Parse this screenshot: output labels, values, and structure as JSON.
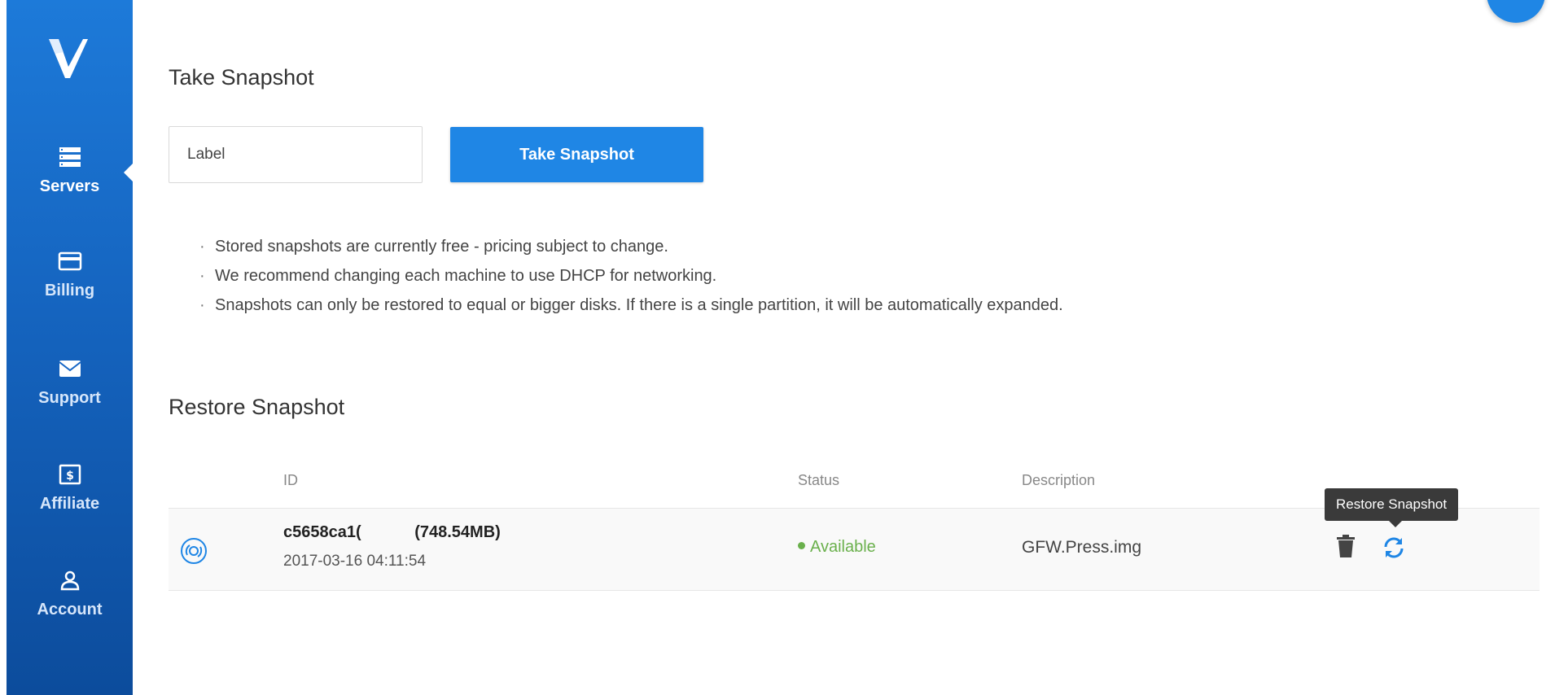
{
  "colors": {
    "sidebar_top": "#1d7ad9",
    "sidebar_bottom": "#0c4c9c",
    "accent": "#1f86e5",
    "status_available": "#6ab04c",
    "tooltip_bg": "#3a3a3a"
  },
  "sidebar": {
    "logo_icon": "v-logo-icon",
    "items": [
      {
        "label": "Servers",
        "icon": "server-list-icon",
        "active": true
      },
      {
        "label": "Billing",
        "icon": "credit-card-icon",
        "active": false
      },
      {
        "label": "Support",
        "icon": "envelope-icon",
        "active": false
      },
      {
        "label": "Affiliate",
        "icon": "dollar-bill-icon",
        "active": false
      },
      {
        "label": "Account",
        "icon": "user-icon",
        "active": false
      }
    ]
  },
  "take_snapshot": {
    "title": "Take Snapshot",
    "label_placeholder": "Label",
    "button_label": "Take Snapshot",
    "notes": [
      "Stored snapshots are currently free - pricing subject to change.",
      "We recommend changing each machine to use DHCP for networking.",
      "Snapshots can only be restored to equal or bigger disks. If there is a single partition, it will be automatically expanded."
    ]
  },
  "restore_snapshot": {
    "title": "Restore Snapshot",
    "columns": {
      "id": "ID",
      "status": "Status",
      "description": "Description"
    },
    "rows": [
      {
        "icon": "disc-icon",
        "id_prefix": "c5658ca1(",
        "size": "(748.54MB)",
        "date": "2017-03-16 04:11:54",
        "status": "Available",
        "description": "GFW.Press.img",
        "actions": [
          "trash-icon",
          "restore-icon"
        ]
      }
    ],
    "tooltip": "Restore Snapshot"
  }
}
